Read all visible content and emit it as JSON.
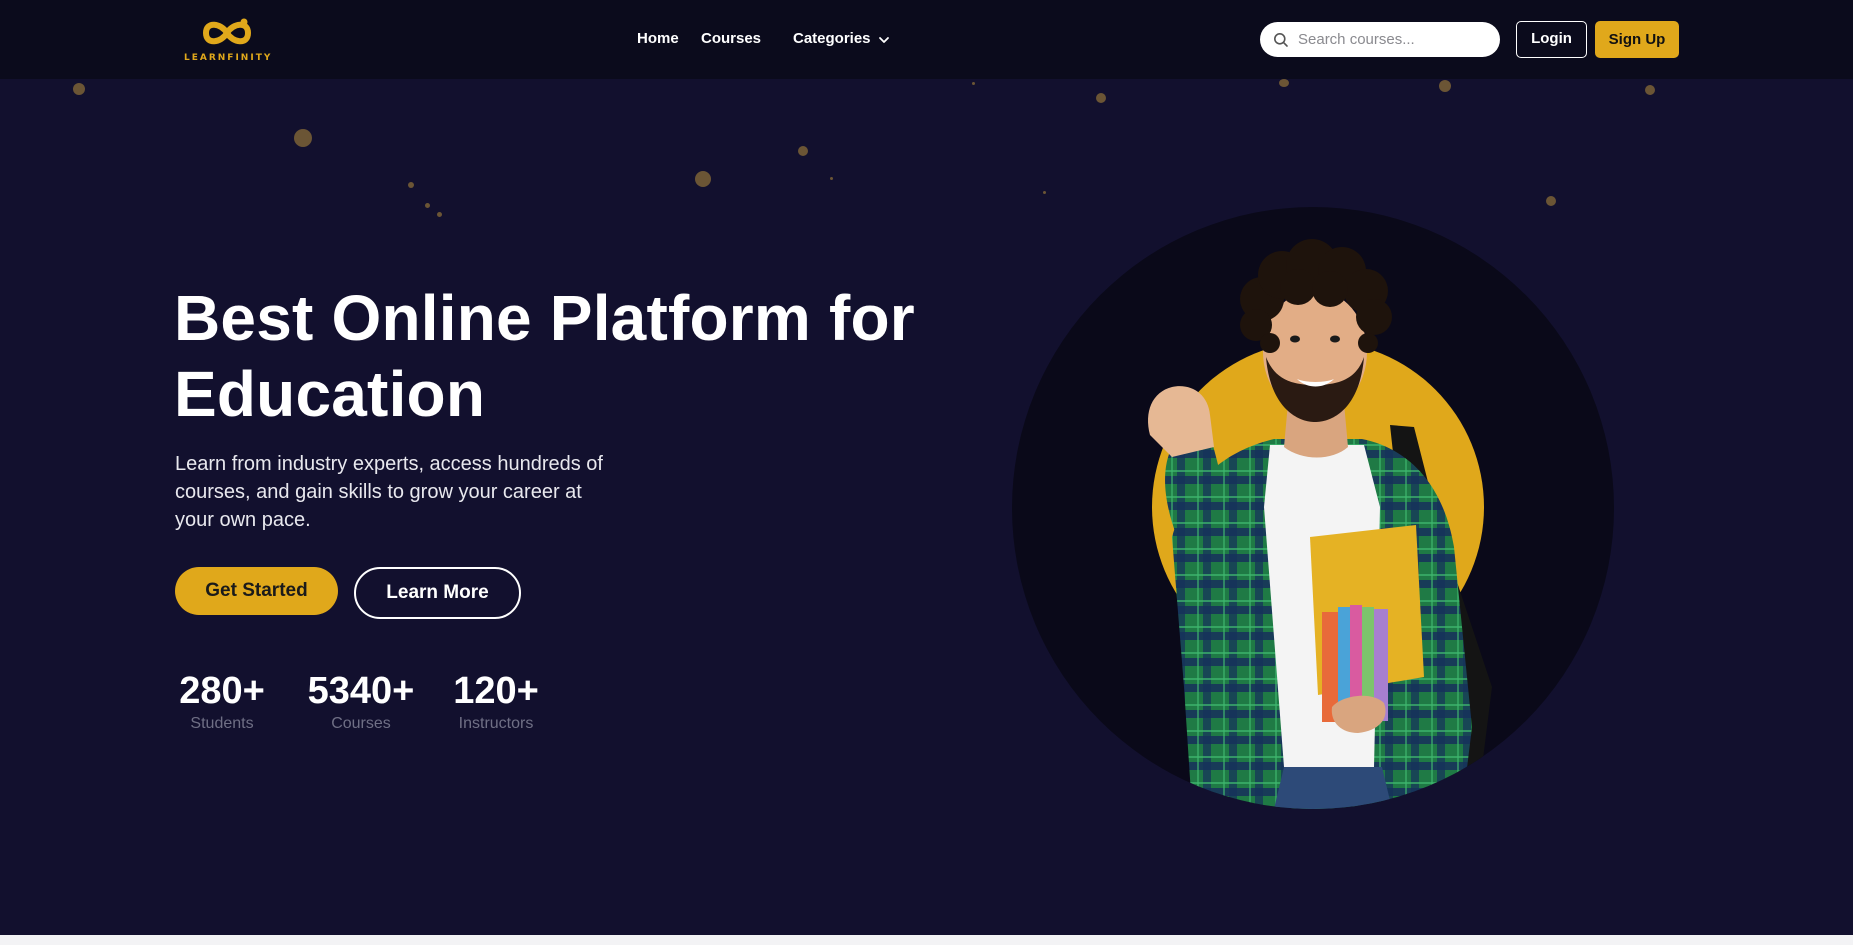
{
  "brand": {
    "name": "LEARNFINITY",
    "accent": "#e0a81b",
    "nav_bg": "#0b0b1c",
    "hero_bg": "#12102e"
  },
  "nav": {
    "links": [
      {
        "label": "Home"
      },
      {
        "label": "Courses"
      },
      {
        "label": "Categories",
        "icon": "chevron-down-icon"
      }
    ],
    "search": {
      "placeholder": "Search courses...",
      "value": "",
      "icon": "search-icon"
    },
    "login_label": "Login",
    "signup_label": "Sign Up"
  },
  "hero": {
    "title_line1": "Best Online Platform for",
    "title_line2": "Education",
    "subtitle": "Learn from industry experts, access hundreds of courses, and gain skills to grow your career at your own pace.",
    "primary_cta": "Get Started",
    "secondary_cta": "Learn More",
    "stats": [
      {
        "value": "280+",
        "label": "Students"
      },
      {
        "value": "5340+",
        "label": "Courses"
      },
      {
        "value": "120+",
        "label": "Instructors"
      }
    ]
  }
}
